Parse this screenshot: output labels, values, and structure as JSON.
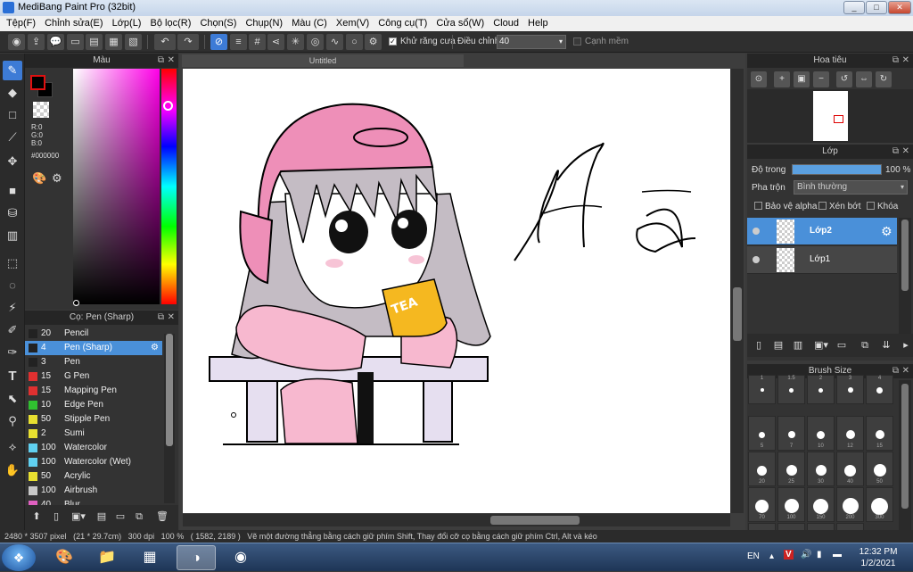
{
  "window": {
    "title": "MediBang Paint Pro (32bit)",
    "min_btn": "_",
    "max_btn": "□",
    "close_btn": "✕"
  },
  "menu": [
    "Tệp(F)",
    "Chỉnh sửa(E)",
    "Lớp(L)",
    "Bộ lọc(R)",
    "Chọn(S)",
    "Chụp(N)",
    "Màu (C)",
    "Xem(V)",
    "Công cụ(T)",
    "Cửa sổ(W)",
    "Cloud",
    "Help"
  ],
  "toolbar": {
    "icons": [
      "color-wheel-icon",
      "export-icon",
      "chat-icon",
      "comment-icon",
      "page-icon",
      "grid-list-icon",
      "layers-icon",
      "undo-icon",
      "redo-icon",
      "snap-off-icon",
      "parallel-snap-icon",
      "grid-snap-icon",
      "perspective-icon",
      "radial-icon",
      "concentric-icon",
      "curve-icon",
      "circle-icon",
      "settings-icon"
    ],
    "antialias_label": "Khử răng cưa",
    "antialias_checked": true,
    "stabilizer_label": "Điều chỉnh",
    "stabilizer_value": "40",
    "soft_edge_label": "Cạnh mềm",
    "soft_edge_checked": false
  },
  "tools": [
    "brush",
    "eraser",
    "shape",
    "dot",
    "move",
    "fill-rect",
    "bucket",
    "gradient",
    "select",
    "lasso",
    "magic-wand",
    "select-pen",
    "select-eraser",
    "text",
    "operation",
    "eyedropper",
    "spoid",
    "hand"
  ],
  "color_panel": {
    "title": "Màu",
    "r": "R:0",
    "g": "G:0",
    "b": "B:0",
    "hex": "#000000",
    "fg_color": "#000000",
    "bg_color": "#000000"
  },
  "brush_panel": {
    "title": "Cọ: Pen (Sharp)",
    "items": [
      {
        "size": "20",
        "name": "Pencil",
        "color": "#222222",
        "selected": false
      },
      {
        "size": "4",
        "name": "Pen (Sharp)",
        "color": "#222222",
        "selected": true
      },
      {
        "size": "3",
        "name": "Pen",
        "color": "#222222",
        "selected": false
      },
      {
        "size": "15",
        "name": "G Pen",
        "color": "#e03030",
        "selected": false
      },
      {
        "size": "15",
        "name": "Mapping Pen",
        "color": "#e03030",
        "selected": false
      },
      {
        "size": "10",
        "name": "Edge Pen",
        "color": "#30c030",
        "selected": false
      },
      {
        "size": "50",
        "name": "Stipple Pen",
        "color": "#e8e030",
        "selected": false
      },
      {
        "size": "2",
        "name": "Sumi",
        "color": "#e8e030",
        "selected": false
      },
      {
        "size": "100",
        "name": "Watercolor",
        "color": "#60d0f0",
        "selected": false
      },
      {
        "size": "100",
        "name": "Watercolor (Wet)",
        "color": "#60d0f0",
        "selected": false
      },
      {
        "size": "50",
        "name": "Acrylic",
        "color": "#e8e030",
        "selected": false
      },
      {
        "size": "100",
        "name": "Airbrush",
        "color": "#c8c8c8",
        "selected": false
      },
      {
        "size": "40",
        "name": "Blur",
        "color": "#e060c0",
        "selected": false
      }
    ]
  },
  "canvas": {
    "tab": "Untitled",
    "handwriting": "Hà"
  },
  "navigator": {
    "title": "Hoa tiêu"
  },
  "layers": {
    "title": "Lớp",
    "opacity_label": "Độ trong",
    "opacity_value": "100 %",
    "opacity": 1.0,
    "blend_label": "Pha trộn",
    "blend_value": "Bình thường",
    "protect_alpha": "Bảo vệ alpha",
    "clipping": "Xén bớt",
    "lock": "Khóa",
    "items": [
      {
        "name": "Lớp2",
        "selected": true
      },
      {
        "name": "Lớp1",
        "selected": false
      }
    ]
  },
  "brush_size": {
    "title": "Brush Size",
    "sizes": [
      "1",
      "1.5",
      "2",
      "3",
      "4",
      "5",
      "7",
      "10",
      "12",
      "15",
      "20",
      "25",
      "30",
      "40",
      "50",
      "70",
      "100",
      "150",
      "200",
      "300",
      "400",
      "500",
      "700",
      "1000"
    ]
  },
  "status": {
    "dimensions": "2480 * 3507 pixel",
    "cm": "(21 * 29.7cm)",
    "dpi": "300 dpi",
    "zoom": "100 %",
    "coords": "( 1582, 2189 )",
    "hint": "Vẽ một đường thẳng bằng cách giữ phím Shift, Thay đổi cỡ cọ bằng cách giữ phím Ctrl, Alt và kéo"
  },
  "taskbar": {
    "lang": "EN",
    "time": "12:32 PM",
    "date": "1/2/2021"
  }
}
